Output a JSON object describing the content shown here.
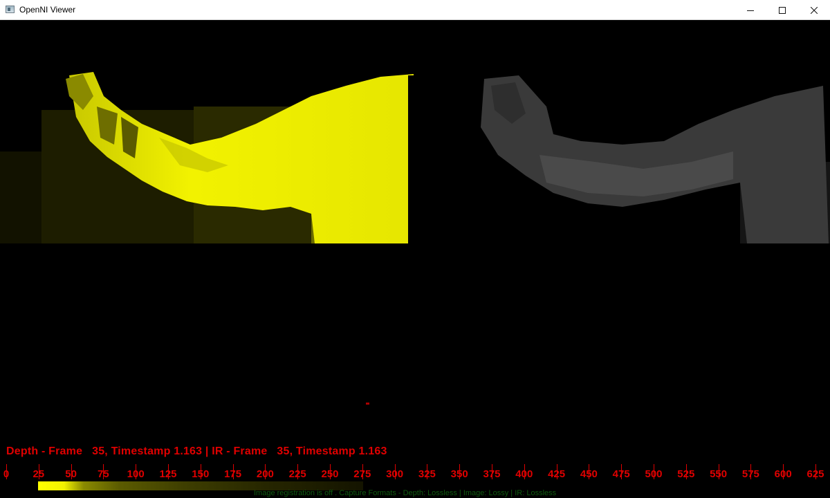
{
  "window": {
    "title": "OpenNI Viewer",
    "minimize_icon": "minimize-icon",
    "maximize_icon": "maximize-icon",
    "close_icon": "close-icon"
  },
  "views": {
    "depth": {
      "icon": "depth-view",
      "color": "#f5f500"
    },
    "ir": {
      "icon": "ir-view",
      "color": "#555555"
    }
  },
  "status": {
    "text": "Depth - Frame   35, Timestamp 1.163 | IR - Frame   35, Timestamp 1.163"
  },
  "ruler": {
    "ticks": [
      "0",
      "25",
      "50",
      "75",
      "100",
      "125",
      "150",
      "175",
      "200",
      "225",
      "250",
      "275",
      "300",
      "325",
      "350",
      "375",
      "400",
      "425",
      "450",
      "475",
      "500",
      "525",
      "550",
      "575",
      "600",
      "625"
    ],
    "color": "#e00000"
  },
  "footer": {
    "text": "Image registration is off . Capture Formats - Depth: Lossless | Image: Lossy | IR: Lossless"
  }
}
